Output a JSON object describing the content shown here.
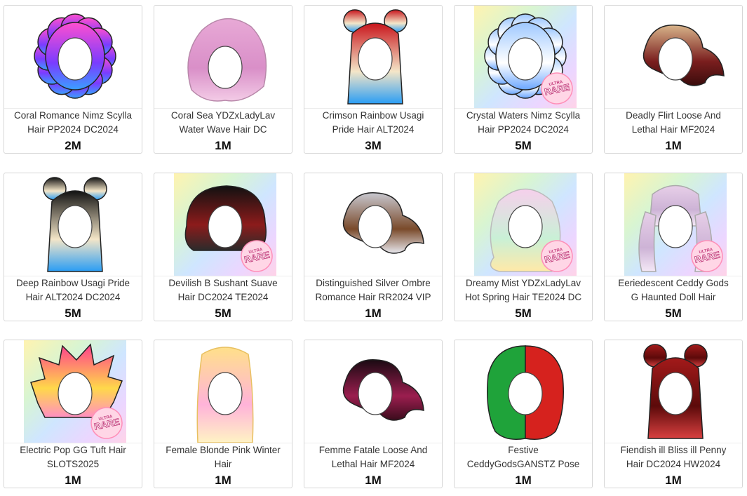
{
  "items": [
    {
      "name_line1": "Coral Romance Nimz Scylla",
      "name_line2": "Hair PP2024 DC2024",
      "price": "2M",
      "style": "curly",
      "colors": [
        "#ff4fcf",
        "#7a3cff",
        "#3aa0ff"
      ],
      "bg": "none",
      "rare": false
    },
    {
      "name_line1": "Coral Sea YDZxLadyLav",
      "name_line2": "Water Wave Hair DC",
      "price": "1M",
      "style": "fluffy",
      "colors": [
        "#e8a9d6",
        "#d98fc8",
        "#f3cbe6"
      ],
      "bg": "none",
      "rare": false
    },
    {
      "name_line1": "Crimson Rainbow Usagi",
      "name_line2": "Pride Hair ALT2024",
      "price": "3M",
      "style": "buns",
      "colors": [
        "#c8141b",
        "#f4e6c8",
        "#2a9df4"
      ],
      "bg": "none",
      "rare": false
    },
    {
      "name_line1": "Crystal Waters Nimz Scylla",
      "name_line2": "Hair PP2024 DC2024",
      "price": "5M",
      "style": "curly",
      "colors": [
        "#9ec8ff",
        "#ffffff",
        "#6aa6ff"
      ],
      "bg": "rainbow",
      "rare": true
    },
    {
      "name_line1": "Deadly Flirt Loose And",
      "name_line2": "Lethal Hair MF2024",
      "price": "1M",
      "style": "wavy-side",
      "colors": [
        "#d8b48a",
        "#7a1e1e",
        "#3a0c0c"
      ],
      "bg": "none",
      "rare": false
    },
    {
      "name_line1": "Deep Rainbow Usagi Pride",
      "name_line2": "Hair ALT2024 DC2024",
      "price": "5M",
      "style": "buns",
      "colors": [
        "#111111",
        "#f4e6c8",
        "#2a9df4"
      ],
      "bg": "none",
      "rare": false
    },
    {
      "name_line1": "Devilish B Sushant Suave",
      "name_line2": "Hair DC2024 TE2024",
      "price": "5M",
      "style": "short",
      "colors": [
        "#111111",
        "#8c1b1b",
        "#2b2b2b"
      ],
      "bg": "rainbow",
      "rare": true
    },
    {
      "name_line1": "Distinguished Silver Ombre",
      "name_line2": "Romance Hair RR2024 VIP",
      "price": "1M",
      "style": "wavy-side",
      "colors": [
        "#c8c8d0",
        "#7a4a2a",
        "#e8e8ee"
      ],
      "bg": "none",
      "rare": false
    },
    {
      "name_line1": "Dreamy Mist YDZxLadyLav",
      "name_line2": "Hot Spring Hair TE2024 DC",
      "price": "5M",
      "style": "long-wavy",
      "colors": [
        "#f6d0ec",
        "#c9f0d6",
        "#ffe9a8"
      ],
      "bg": "rainbow",
      "rare": true
    },
    {
      "name_line1": "Eeriedescent Ceddy Gods",
      "name_line2": "G Haunted Doll Hair",
      "price": "5M",
      "style": "pigtails",
      "colors": [
        "#e7cfe8",
        "#cdb3d6",
        "#f4e8f6"
      ],
      "bg": "rainbow",
      "rare": true
    },
    {
      "name_line1": "Electric Pop GG Tuft Hair",
      "name_line2": "SLOTS2025",
      "price": "1M",
      "style": "spiky",
      "colors": [
        "#ff3f8e",
        "#ffd84a",
        "#ff8fc2"
      ],
      "bg": "rainbow",
      "rare": true
    },
    {
      "name_line1": "Female Blonde Pink Winter",
      "name_line2": "Hair",
      "price": "1M",
      "style": "long-straight",
      "colors": [
        "#ffe08a",
        "#ffb3d9",
        "#fff3c4"
      ],
      "bg": "none",
      "rare": false
    },
    {
      "name_line1": "Femme Fatale Loose And",
      "name_line2": "Lethal Hair MF2024",
      "price": "1M",
      "style": "wavy-side",
      "colors": [
        "#1a0a12",
        "#9b1e4f",
        "#3a0c1c"
      ],
      "bg": "none",
      "rare": false
    },
    {
      "name_line1": "Festive",
      "name_line2": "CeddyGodsGANSTZ Pose",
      "price": "1M",
      "style": "bob",
      "colors": [
        "#1fa33a",
        "#d6221e",
        "#ffffff"
      ],
      "bg": "none",
      "rare": false
    },
    {
      "name_line1": "Fiendish ill Bliss ill Penny",
      "name_line2": "Hair DC2024 HW2024",
      "price": "1M",
      "style": "buns",
      "colors": [
        "#a31a1a",
        "#5c0a0a",
        "#d84040"
      ],
      "bg": "none",
      "rare": false
    }
  ],
  "badge": {
    "top_text": "ULTRA",
    "main_text": "RARE"
  }
}
